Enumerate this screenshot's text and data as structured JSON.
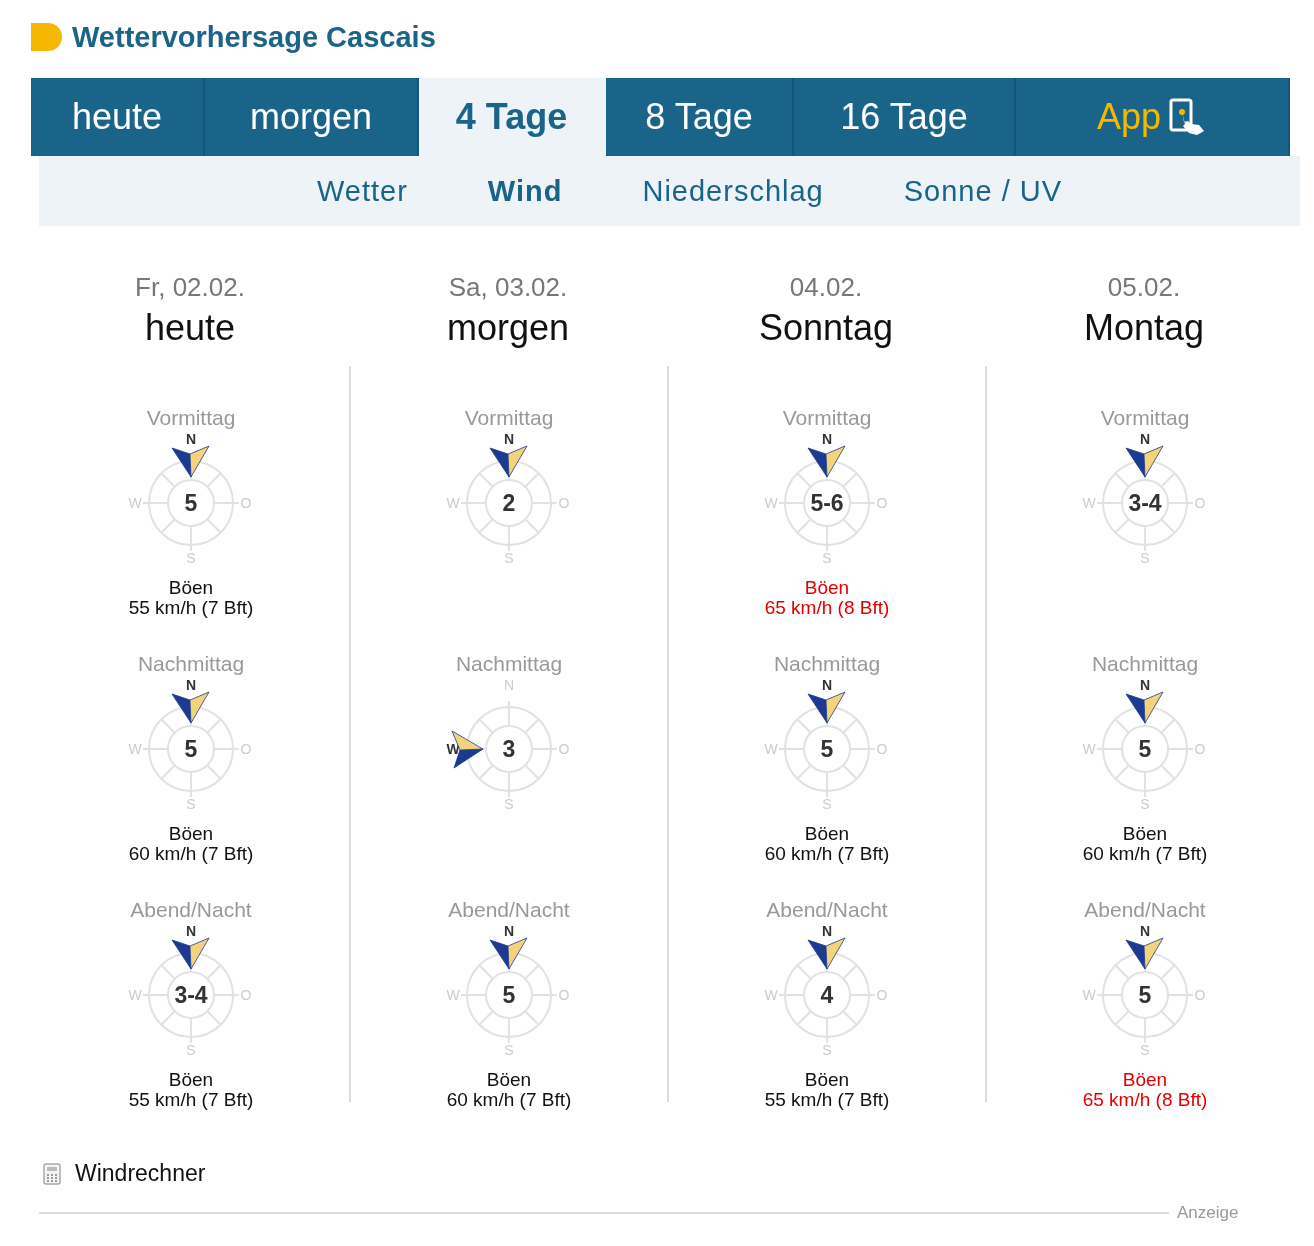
{
  "title": "Wettervorhersage Cascais",
  "tabs": [
    {
      "label": "heute",
      "selected": false,
      "kind": "text"
    },
    {
      "label": "morgen",
      "selected": false,
      "kind": "text"
    },
    {
      "label": "4 Tage",
      "selected": true,
      "kind": "text"
    },
    {
      "label": "8 Tage",
      "selected": false,
      "kind": "text"
    },
    {
      "label": "16 Tage",
      "selected": false,
      "kind": "text"
    },
    {
      "label": "App",
      "selected": false,
      "kind": "app"
    }
  ],
  "subtabs": [
    {
      "label": "Wetter",
      "selected": false
    },
    {
      "label": "Wind",
      "selected": true
    },
    {
      "label": "Niederschlag",
      "selected": false
    },
    {
      "label": "Sonne / UV",
      "selected": false
    }
  ],
  "days": [
    {
      "date": "Fr, 02.02.",
      "name": "heute",
      "periods": [
        {
          "label": "Vormittag",
          "force": "5",
          "kind": "n",
          "letters": {
            "n": "N",
            "w": "W",
            "o": "O",
            "s": "S"
          },
          "gust_label": "Böen",
          "gust": "55 km/h (7 Bft)",
          "warning": false
        },
        {
          "label": "Nachmittag",
          "force": "5",
          "kind": "n",
          "letters": {
            "n": "N",
            "w": "W",
            "o": "O",
            "s": "S"
          },
          "gust_label": "Böen",
          "gust": "60 km/h (7 Bft)",
          "warning": false
        },
        {
          "label": "Abend/Nacht",
          "force": "3-4",
          "kind": "n",
          "letters": {
            "n": "N",
            "w": "W",
            "o": "O",
            "s": "S"
          },
          "gust_label": "Böen",
          "gust": "55 km/h (7 Bft)",
          "warning": false
        }
      ]
    },
    {
      "date": "Sa, 03.02.",
      "name": "morgen",
      "periods": [
        {
          "label": "Vormittag",
          "force": "2",
          "kind": "n",
          "letters": {
            "n": "N",
            "w": "W",
            "o": "O",
            "s": "S"
          }
        },
        {
          "label": "Nachmittag",
          "force": "3",
          "kind": "w",
          "letters": {
            "n": "N",
            "w": "W",
            "o": "O",
            "s": "S"
          }
        },
        {
          "label": "Abend/Nacht",
          "force": "5",
          "kind": "n",
          "letters": {
            "n": "N",
            "w": "W",
            "o": "O",
            "s": "S"
          },
          "gust_label": "Böen",
          "gust": "60 km/h (7 Bft)",
          "warning": false
        }
      ]
    },
    {
      "date": "04.02.",
      "name": "Sonntag",
      "periods": [
        {
          "label": "Vormittag",
          "force": "5-6",
          "kind": "n",
          "letters": {
            "n": "N",
            "w": "W",
            "o": "O",
            "s": "S"
          },
          "gust_label": "Böen",
          "gust": "65 km/h (8 Bft)",
          "warning": true
        },
        {
          "label": "Nachmittag",
          "force": "5",
          "kind": "n",
          "letters": {
            "n": "N",
            "w": "W",
            "o": "O",
            "s": "S"
          },
          "gust_label": "Böen",
          "gust": "60 km/h (7 Bft)",
          "warning": false
        },
        {
          "label": "Abend/Nacht",
          "force": "4",
          "kind": "n",
          "letters": {
            "n": "N",
            "w": "W",
            "o": "O",
            "s": "S"
          },
          "gust_label": "Böen",
          "gust": "55 km/h (7 Bft)",
          "warning": false
        }
      ]
    },
    {
      "date": "05.02.",
      "name": "Montag",
      "periods": [
        {
          "label": "Vormittag",
          "force": "3-4",
          "kind": "n",
          "letters": {
            "n": "N",
            "w": "W",
            "o": "O",
            "s": "S"
          }
        },
        {
          "label": "Nachmittag",
          "force": "5",
          "kind": "n",
          "letters": {
            "n": "N",
            "w": "W",
            "o": "O",
            "s": "S"
          },
          "gust_label": "Böen",
          "gust": "60 km/h (7 Bft)",
          "warning": false
        },
        {
          "label": "Abend/Nacht",
          "force": "5",
          "kind": "n",
          "letters": {
            "n": "N",
            "w": "W",
            "o": "O",
            "s": "S"
          },
          "gust_label": "Böen",
          "gust": "65 km/h (8 Bft)",
          "warning": true
        }
      ]
    }
  ],
  "calculator_link": "Windrechner",
  "ad_label": "Anzeige"
}
